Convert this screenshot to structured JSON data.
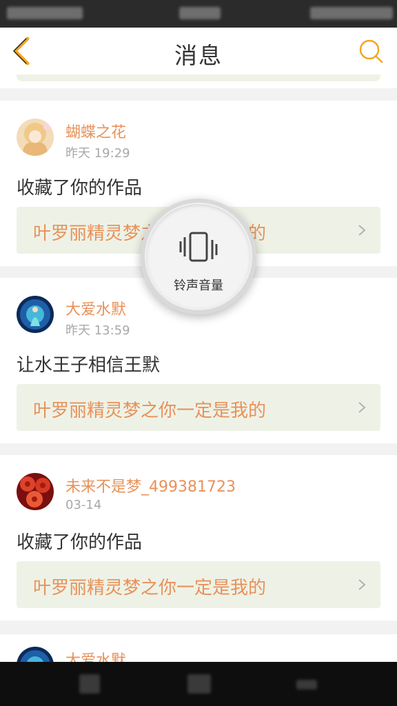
{
  "header": {
    "title": "消息",
    "back_icon": "chevron-left-icon",
    "search_icon": "search-icon",
    "accent": "#f5a623"
  },
  "messages": [
    {
      "name": "蝴蝶之花",
      "time": "昨天 19:29",
      "action": "收藏了你的作品",
      "work": "叶罗丽精灵梦之你一定是我的"
    },
    {
      "name": "大爱水默",
      "time": "昨天 13:59",
      "action": "让水王子相信王默",
      "work": "叶罗丽精灵梦之你一定是我的"
    },
    {
      "name": "未来不是梦_499381723",
      "time": "03-14",
      "action": "收藏了你的作品",
      "work": "叶罗丽精灵梦之你一定是我的"
    }
  ],
  "peek": {
    "name": "大爱水默"
  },
  "toast": {
    "label": "铃声音量",
    "icon": "vibrate-icon"
  },
  "colors": {
    "name": "#e8915a",
    "work_bg": "#eef2e6",
    "time": "#a8a8a8"
  }
}
